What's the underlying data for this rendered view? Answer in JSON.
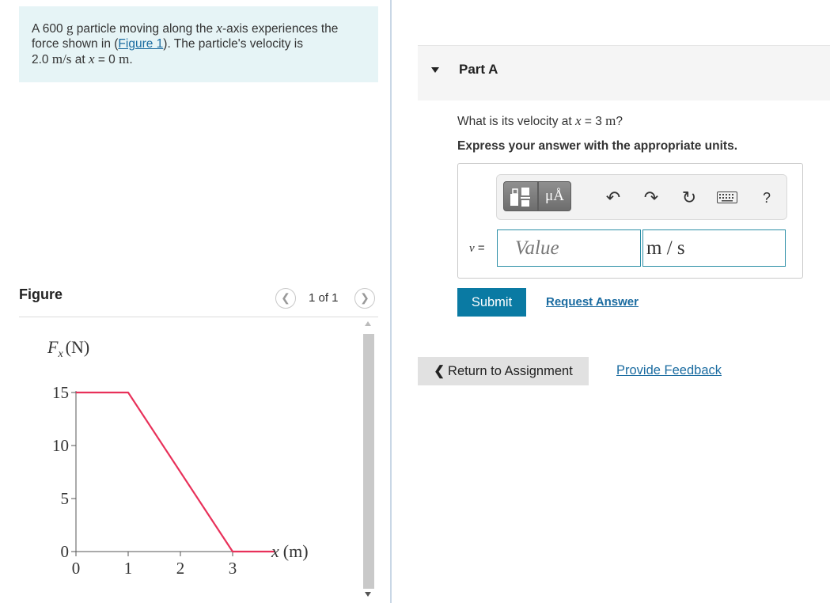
{
  "problem": {
    "line1_pre": "A 600 ",
    "line1_mass_unit": "g",
    "line1_mid": " particle moving along the ",
    "line1_axis": "x",
    "line1_post": "-axis experiences the",
    "line2_pre": "force shown in (",
    "figure_link": "Figure 1",
    "line2_post": "). The particle's velocity is",
    "line3_value": "2.0 ",
    "line3_unit": "m/s",
    "line3_mid": " at ",
    "line3_var": "x",
    "line3_eq": " = 0 ",
    "line3_pos_unit": "m",
    "line3_end": "."
  },
  "figure": {
    "title": "Figure",
    "prev_icon": "chevron-left-icon",
    "next_icon": "chevron-right-icon",
    "counter": "1 of 1"
  },
  "chart_data": {
    "type": "line",
    "ylabel_var": "F",
    "ylabel_sub": "x",
    "ylabel_unit": "(N)",
    "xlabel_var": "x",
    "xlabel_unit": "(m)",
    "x_ticks": [
      "0",
      "1",
      "2",
      "3"
    ],
    "y_ticks": [
      "0",
      "5",
      "10",
      "15"
    ],
    "xlim": [
      0,
      3
    ],
    "ylim": [
      0,
      15
    ],
    "series": [
      {
        "x": [
          0,
          1,
          3,
          3.8
        ],
        "y": [
          15,
          15,
          0,
          0
        ],
        "color": "#e8315a"
      }
    ],
    "grid": false
  },
  "part": {
    "title": "Part A",
    "question_pre": "What is its velocity at ",
    "question_var": "x",
    "question_mid": " = 3 ",
    "question_unit": "m",
    "question_end": "?",
    "instruction": "Express your answer with the appropriate units."
  },
  "toolbar": {
    "template_icon": "templates-icon",
    "units_label": "μÅ",
    "undo_icon": "undo-icon",
    "redo_icon": "redo-icon",
    "reset_icon": "reset-icon",
    "keyboard_icon": "keyboard-icon",
    "help_label": "?"
  },
  "answer": {
    "variable": "v",
    "equals": " =",
    "value_placeholder": "Value",
    "units_value": "m / s"
  },
  "actions": {
    "submit": "Submit",
    "request_answer": "Request Answer",
    "return_label": "Return to Assignment",
    "provide_feedback": "Provide Feedback"
  },
  "colors": {
    "accent": "#0a7aa3",
    "link": "#1a6ba0",
    "problem_bg": "#e6f4f6",
    "plot_line": "#e8315a"
  }
}
